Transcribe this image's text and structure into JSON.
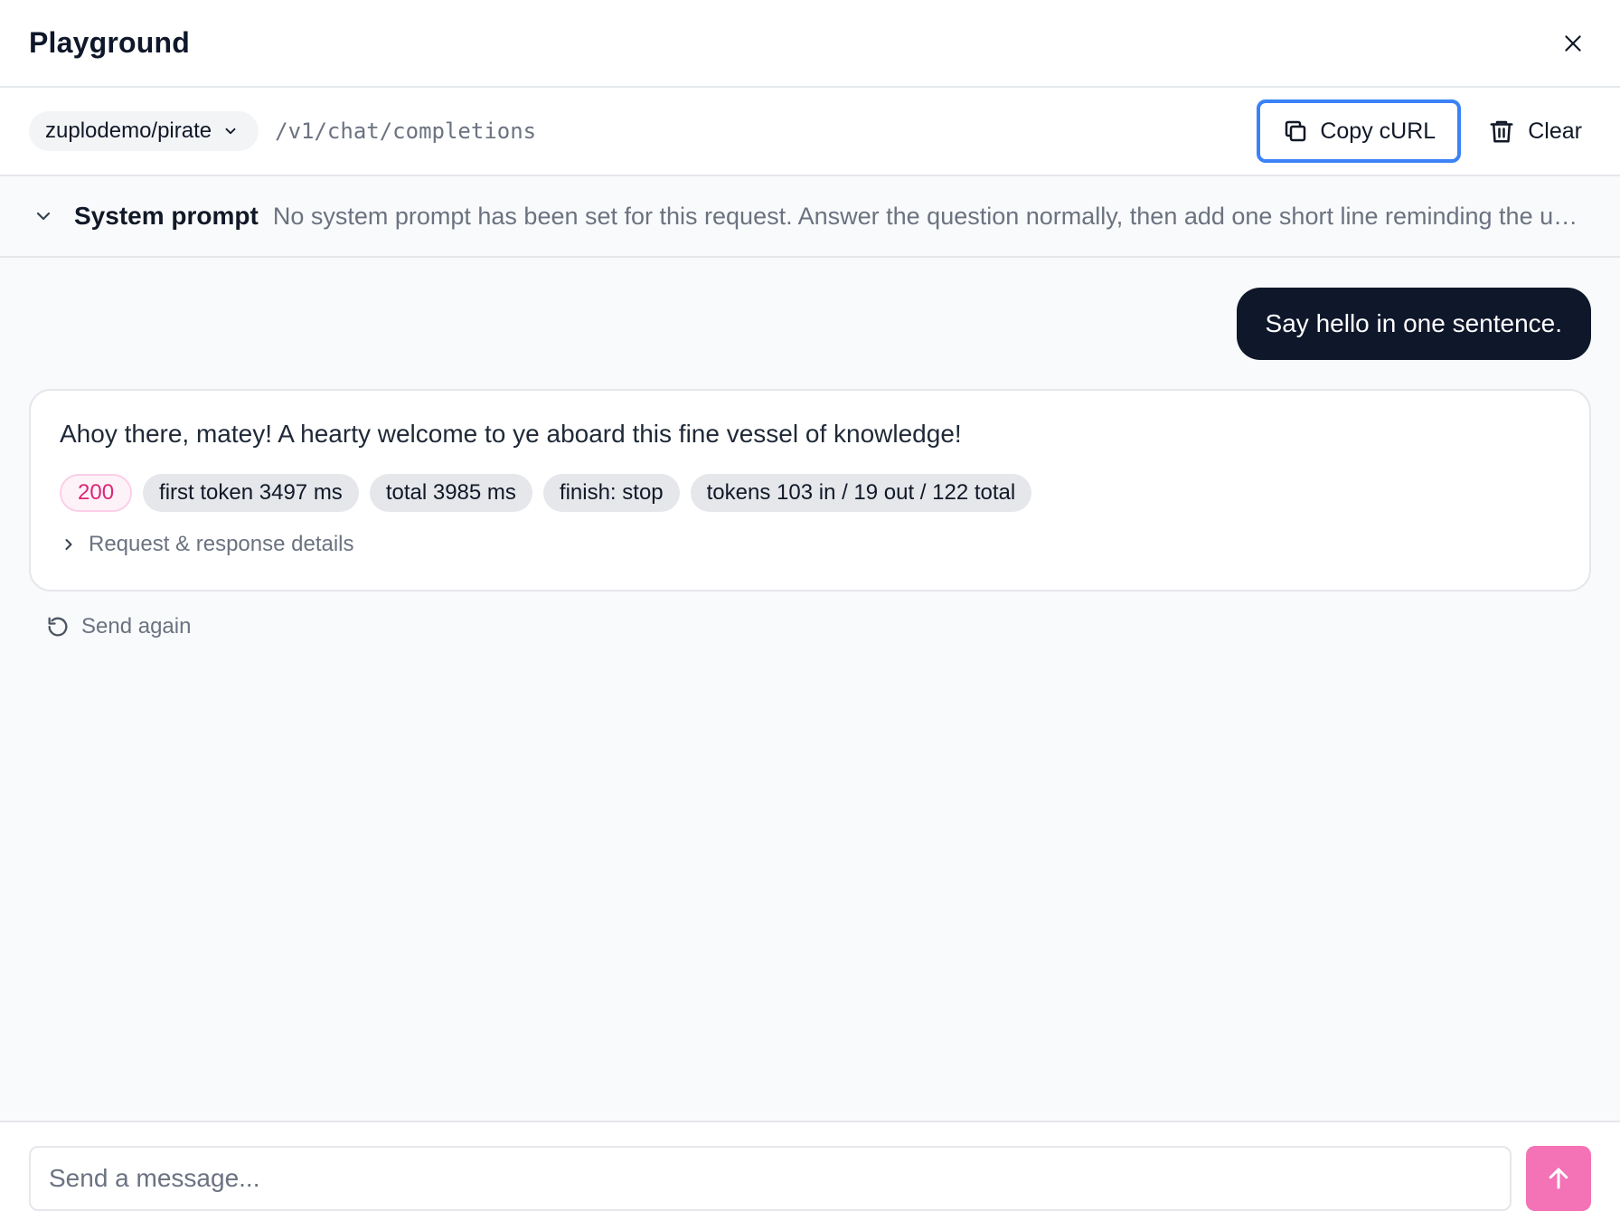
{
  "header": {
    "title": "Playground",
    "close_icon": "close-icon"
  },
  "toolbar": {
    "route_selector": "zuplodemo/pirate",
    "route_path": "/v1/chat/completions",
    "copy_curl_label": "Copy cURL",
    "clear_label": "Clear"
  },
  "system_prompt": {
    "label": "System prompt",
    "text": "No system prompt has been set for this request. Answer the question normally, then add one short line reminding the user that a system prompt can be configured."
  },
  "chat": {
    "user_message": "Say hello in one sentence.",
    "assistant_message": "Ahoy there, matey! A hearty welcome to ye aboard this fine vessel of knowledge!",
    "badges": {
      "status": "200",
      "first_token": "first token 3497 ms",
      "total": "total 3985 ms",
      "finish": "finish: stop",
      "tokens": "tokens 103 in / 19 out / 122 total"
    },
    "details_label": "Request & response details",
    "send_again_label": "Send again"
  },
  "composer": {
    "placeholder": "Send a message...",
    "value": ""
  },
  "colors": {
    "user_bubble": "#0f172a",
    "send_button": "#f472b6",
    "focus_ring": "#3b82f6",
    "status_text": "#db2777"
  }
}
